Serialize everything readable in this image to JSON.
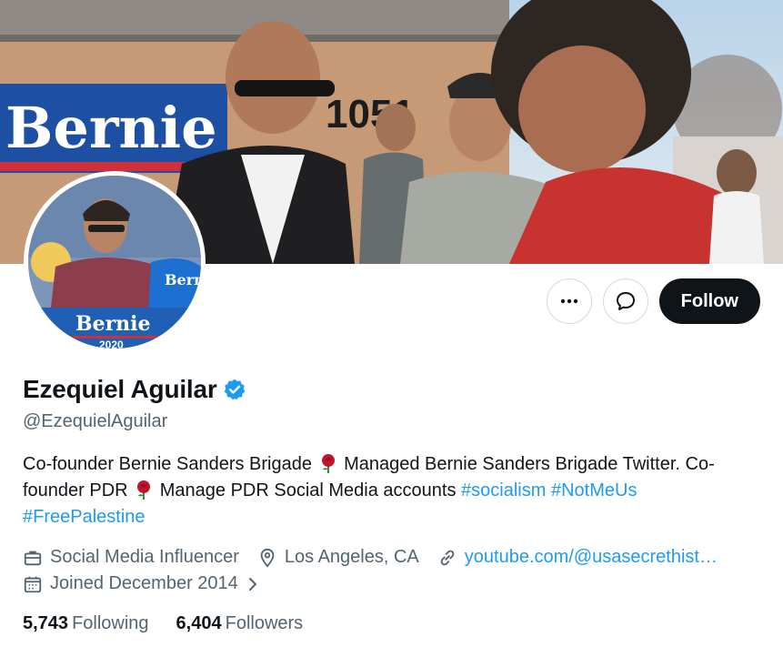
{
  "banner": {
    "sign_text": "Bernie",
    "address_number": "1051"
  },
  "avatar": {
    "shirt_text": "Bernie",
    "sign_text": "Bernie",
    "sign_year": "2020"
  },
  "actions": {
    "more_icon": "more-horizontal-icon",
    "message_icon": "message-bubble-icon",
    "follow_label": "Follow"
  },
  "profile": {
    "display_name": "Ezequiel Aguilar",
    "verified_icon": "verified-badge-icon",
    "handle": "@EzequielAguilar",
    "bio": {
      "part1": "Co-founder Bernie Sanders Brigade",
      "part2": "Managed Bernie Sanders Brigade Twitter. Co-founder PDR",
      "part3": "Manage PDR Social Media accounts",
      "hashtags": [
        "#socialism",
        "#NotMeUs",
        "#FreePalestine"
      ],
      "emoji": "rose-icon"
    },
    "occupation": "Social Media Influencer",
    "location": "Los Angeles, CA",
    "website": "youtube.com/@usasecrethist…",
    "joined": "Joined December 2014"
  },
  "stats": {
    "following_count": "5,743",
    "following_label": "Following",
    "followers_count": "6,404",
    "followers_label": "Followers"
  },
  "colors": {
    "accent": "#1d9bf0",
    "text_primary": "#0f1419",
    "text_secondary": "#536471",
    "follow_bg": "#0f1419"
  }
}
